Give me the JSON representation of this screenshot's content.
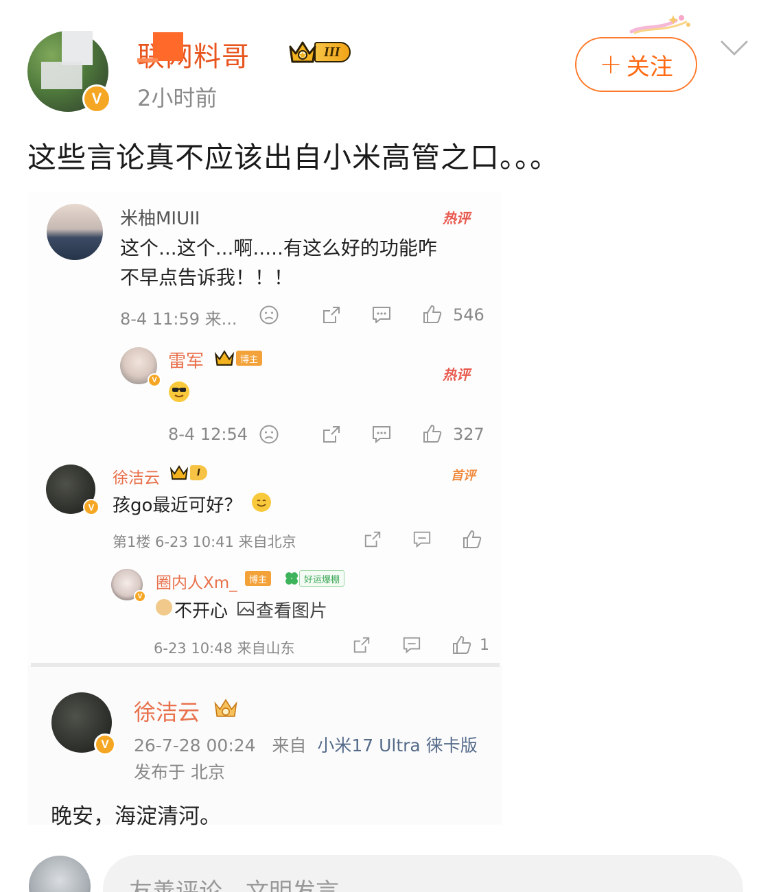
{
  "post": {
    "author_name": "联网料哥",
    "level_badge": "III",
    "time": "2小时前",
    "follow_label": "关注",
    "text": "这些言论真不应该出自小米高管之口。。。",
    "accent_color": "#ff6a13"
  },
  "screenshot": {
    "comment1": {
      "name": "米柚MIUII",
      "tag": "热评",
      "text_line1": "这个...这个...啊.....有这么好的功能咋",
      "text_line2": "不早点告诉我！！！",
      "meta": "8-4 11:59 来...",
      "likes": "546"
    },
    "reply1": {
      "name": "雷军",
      "role_tag": "博主",
      "tag": "热评",
      "meta": "8-4 12:54",
      "likes": "327"
    },
    "comment2": {
      "name": "徐洁云",
      "level_badge": "I",
      "tag": "首评",
      "text": "孩go最近可好？",
      "meta": "第1楼 6-23 10:41 来自北京"
    },
    "reply2": {
      "name": "圈内人Xm_",
      "role_tag": "博主",
      "luck_tag": "好运爆棚",
      "text": "不开心 ",
      "link": "查看图片",
      "meta": "6-23 10:48 来自山东",
      "likes": "1"
    },
    "post2": {
      "name": "徐洁云",
      "meta_time": "26-7-28 00:24",
      "meta_from": "来自",
      "meta_device": "小米17 Ultra 徕卡版",
      "meta_loc": "发布于 北京",
      "text": "晚安，海淀清河。"
    }
  },
  "comment_bar": {
    "placeholder": "友善评论，文明发言"
  }
}
